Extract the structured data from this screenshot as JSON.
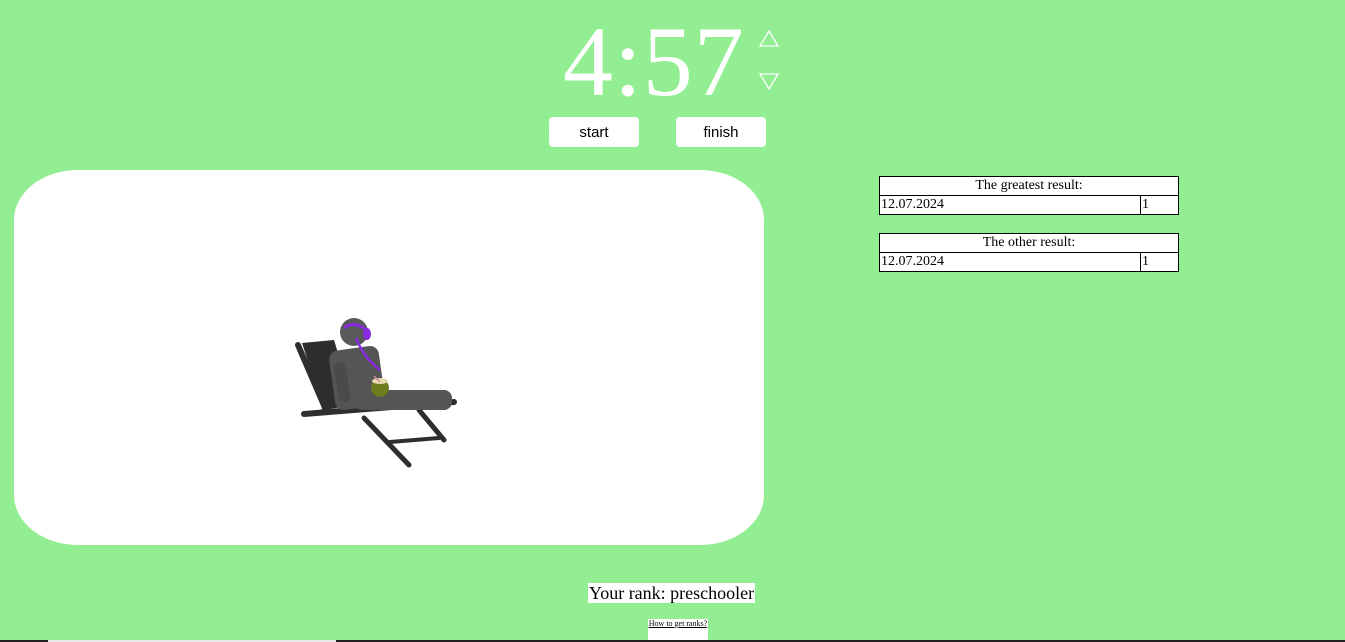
{
  "timer": {
    "value": "4:57",
    "up_icon": "triangle-up-icon",
    "down_icon": "triangle-down-icon"
  },
  "controls": {
    "start_label": "start",
    "finish_label": "finish"
  },
  "greatest": {
    "header": "The greatest result:",
    "rows": [
      {
        "date": "12.07.2024",
        "value": "1"
      }
    ]
  },
  "other": {
    "header": "The other result:",
    "rows": [
      {
        "date": "12.07.2024",
        "value": "1"
      }
    ]
  },
  "rank": {
    "text": "Your rank: preschooler",
    "link_label": "How to get ranks?"
  },
  "colors": {
    "background": "#93ee93",
    "panel": "#ffffff",
    "headphones": "#8a2be2",
    "chair": "#2e2e2e"
  }
}
